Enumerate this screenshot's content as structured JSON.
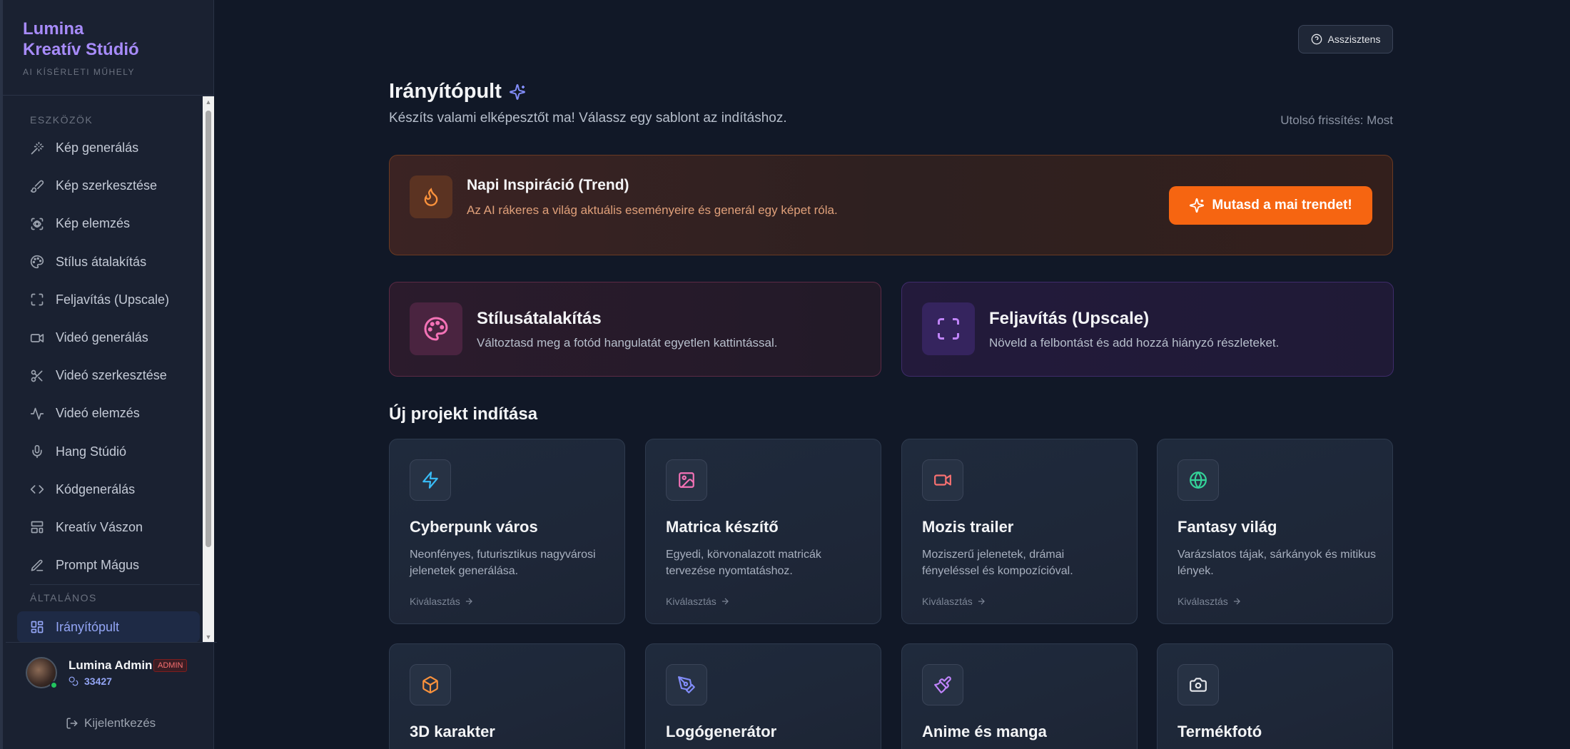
{
  "brand": {
    "title_line1": "Lumina",
    "title_line2": "Kreatív Stúdió",
    "subtitle": "AI KÍSÉRLETI MŰHELY"
  },
  "sidebar": {
    "section_tools": "ESZKÖZÖK",
    "section_general": "ÁLTALÁNOS",
    "items": [
      {
        "label": "Kép generálás",
        "icon": "magic-wand-icon"
      },
      {
        "label": "Kép szerkesztése",
        "icon": "brush-icon"
      },
      {
        "label": "Kép elemzés",
        "icon": "scan-eye-icon"
      },
      {
        "label": "Stílus átalakítás",
        "icon": "palette-icon"
      },
      {
        "label": "Feljavítás (Upscale)",
        "icon": "maximize-icon"
      },
      {
        "label": "Videó generálás",
        "icon": "video-icon"
      },
      {
        "label": "Videó szerkesztése",
        "icon": "scissors-icon"
      },
      {
        "label": "Videó elemzés",
        "icon": "activity-icon"
      },
      {
        "label": "Hang Stúdió",
        "icon": "microphone-icon"
      },
      {
        "label": "Kódgenerálás",
        "icon": "code-icon"
      },
      {
        "label": "Kreatív Vászon",
        "icon": "layout-icon"
      },
      {
        "label": "Prompt Mágus",
        "icon": "pen-icon"
      }
    ],
    "general_items": [
      {
        "label": "Irányítópult",
        "icon": "dashboard-icon",
        "active": true
      }
    ]
  },
  "user": {
    "name": "Lumina Admin",
    "badge": "ADMIN",
    "credits": "33427",
    "logout": "Kijelentkezés"
  },
  "header": {
    "assistant": "Asszisztens",
    "title": "Irányítópult",
    "subtitle": "Készíts valami elképesztőt ma! Válassz egy sablont az indításhoz.",
    "last_update": "Utolsó frissítés: Most"
  },
  "trend": {
    "title": "Napi Inspiráció (Trend)",
    "description": "Az AI rákeres a világ aktuális eseményeire és generál egy képet róla.",
    "button": "Mutasd a mai trendet!"
  },
  "features": [
    {
      "title": "Stílusátalakítás",
      "description": "Változtasd meg a fotód hangulatát egyetlen kattintással."
    },
    {
      "title": "Feljavítás (Upscale)",
      "description": "Növeld a felbontást és add hozzá hiányzó részleteket."
    }
  ],
  "projects_title": "Új projekt indítása",
  "cards": [
    {
      "title": "Cyberpunk város",
      "description": "Neonfényes, futurisztikus nagyvárosi jelenetek generálása.",
      "link": "Kiválasztás",
      "icon": "zap-icon",
      "color": "#38bdf8"
    },
    {
      "title": "Matrica készítő",
      "description": "Egyedi, körvonalazott matricák tervezése nyomtatáshoz.",
      "link": "Kiválasztás",
      "icon": "image-icon",
      "color": "#f472b6"
    },
    {
      "title": "Mozis trailer",
      "description": "Moziszerű jelenetek, drámai fényeléssel és kompozícióval.",
      "link": "Kiválasztás",
      "icon": "video-icon",
      "color": "#f87171"
    },
    {
      "title": "Fantasy világ",
      "description": "Varázslatos tájak, sárkányok és mitikus lények.",
      "link": "Kiválasztás",
      "icon": "globe-icon",
      "color": "#34d399"
    },
    {
      "title": "3D karakter",
      "description": "",
      "link": "",
      "icon": "box-icon",
      "color": "#fb923c"
    },
    {
      "title": "Logógenerátor",
      "description": "",
      "link": "",
      "icon": "pen-tool-icon",
      "color": "#818cf8"
    },
    {
      "title": "Anime és manga",
      "description": "",
      "link": "",
      "icon": "paintbrush-icon",
      "color": "#c084fc"
    },
    {
      "title": "Termékfotó",
      "description": "",
      "link": "",
      "icon": "camera-icon",
      "color": "#e5e7eb"
    }
  ]
}
